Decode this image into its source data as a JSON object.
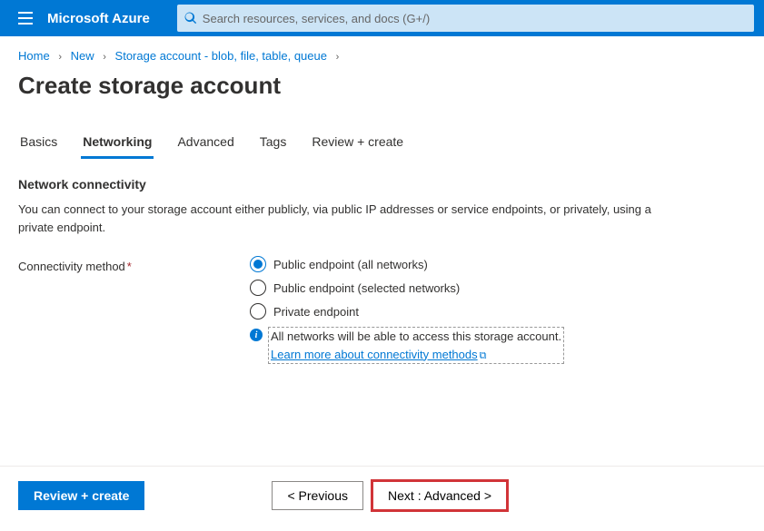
{
  "header": {
    "brand": "Microsoft Azure",
    "search_placeholder": "Search resources, services, and docs (G+/)"
  },
  "breadcrumb": {
    "items": [
      "Home",
      "New",
      "Storage account - blob, file, table, queue"
    ]
  },
  "page": {
    "title": "Create storage account"
  },
  "tabs": [
    "Basics",
    "Networking",
    "Advanced",
    "Tags",
    "Review + create"
  ],
  "active_tab": "Networking",
  "section": {
    "heading": "Network connectivity",
    "description": "You can connect to your storage account either publicly, via public IP addresses or service endpoints, or privately, using a private endpoint."
  },
  "form": {
    "connectivity_label": "Connectivity method",
    "options": [
      "Public endpoint (all networks)",
      "Public endpoint (selected networks)",
      "Private endpoint"
    ],
    "selected_option": 0,
    "info_text": "All networks will be able to access this storage account.",
    "info_link": "Learn more about connectivity methods"
  },
  "footer": {
    "review": "Review + create",
    "previous": "< Previous",
    "next": "Next : Advanced  >"
  }
}
